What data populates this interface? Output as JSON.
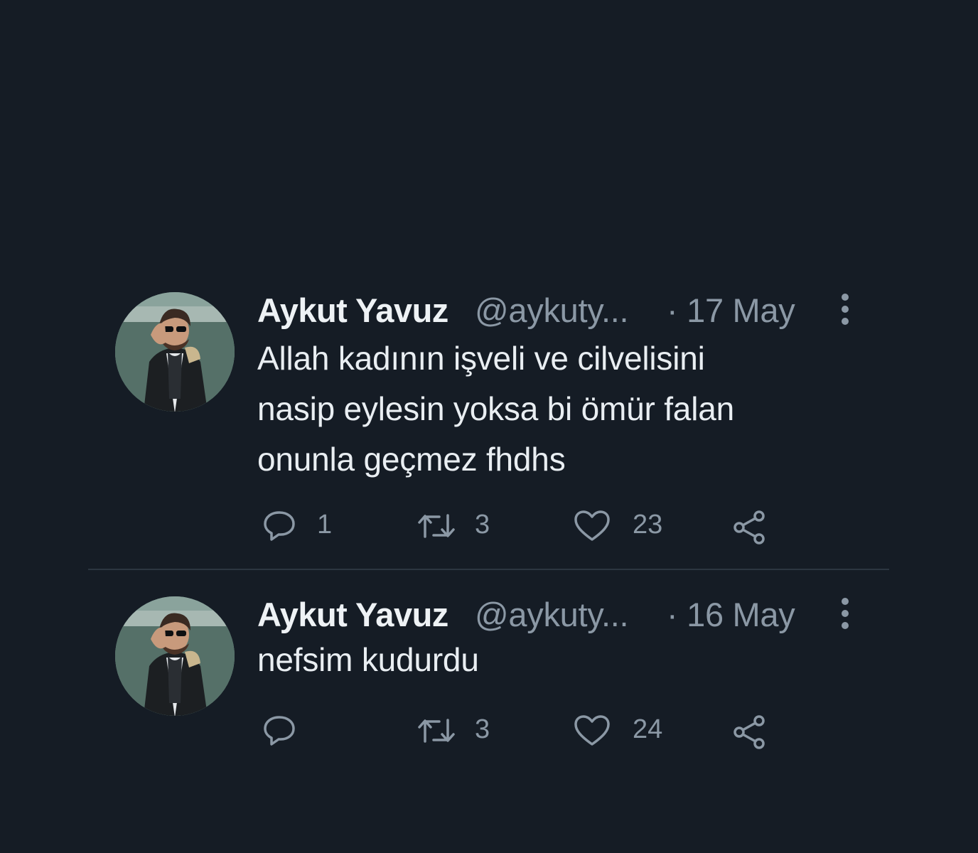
{
  "colors": {
    "background": "#151c25",
    "text": "#e9eef2",
    "muted": "#8b98a5",
    "divider": "#2c3641"
  },
  "tweets": [
    {
      "author_name": "Aykut Yavuz",
      "author_handle": "@aykuty...",
      "date": "· 17 May",
      "text_lines": [
        "Allah kadının işveli ve cilvelisini",
        "nasip eylesin yoksa bi ömür falan",
        "onunla geçmez fhdhs"
      ],
      "reply_count": "1",
      "retweet_count": "3",
      "like_count": "23",
      "icons": [
        "avatar",
        "more-vertical-icon",
        "reply-icon",
        "retweet-icon",
        "like-icon",
        "share-icon"
      ]
    },
    {
      "author_name": "Aykut Yavuz",
      "author_handle": "@aykuty...",
      "date": "· 16 May",
      "text_lines": [
        "nefsim kudurdu"
      ],
      "reply_count": "",
      "retweet_count": "3",
      "like_count": "24",
      "icons": [
        "avatar",
        "more-vertical-icon",
        "reply-icon",
        "retweet-icon",
        "like-icon",
        "share-icon"
      ]
    }
  ]
}
